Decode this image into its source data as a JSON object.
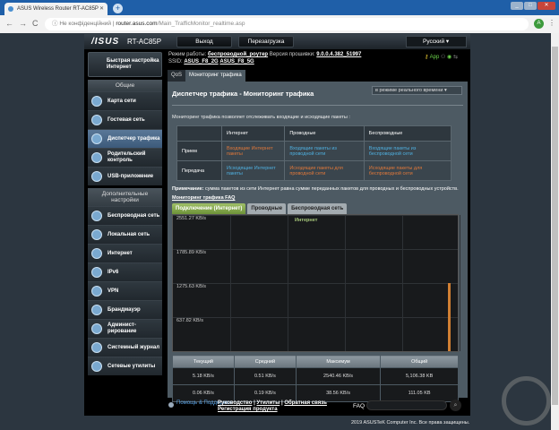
{
  "browser": {
    "tab_title": "ASUS Wireless Router RT-AC85P",
    "not_secure": "Не конфіденційний",
    "url_host": "router.asus.com",
    "url_path": "/Main_TrafficMonitor_realtime.asp",
    "profile": "A"
  },
  "header": {
    "logo": "/ISUS",
    "model": "RT-AC85P",
    "logout": "Выход",
    "reboot": "Перезагрузка",
    "language": "Русский"
  },
  "status": {
    "mode_label": "Режим работы:",
    "mode": "беспроводной_роутер",
    "fw_label": "Версия прошивки:",
    "fw": "9.0.0.4.382_51997",
    "ssid_label": "SSID:",
    "ssid1": "ASUS_F8_2G",
    "ssid2": "ASUS_F8_5G",
    "app": "App"
  },
  "sidebar": {
    "quick_setup": "Быстрая настройка Интернет",
    "general_title": "Общие",
    "general": [
      "Карта сети",
      "Гостевая сеть",
      "Диспетчер трафика",
      "Родительский контроль",
      "USB-приложение"
    ],
    "advanced_title": "Дополнительные настройки",
    "advanced": [
      "Беспроводная сеть",
      "Локальная сеть",
      "Интернет",
      "IPv6",
      "VPN",
      "Брандмауэр",
      "Админист­рирование",
      "Системный журнал",
      "Сетевые утилиты"
    ]
  },
  "content_tabs": [
    "QoS",
    "Мониторинг трафика"
  ],
  "page": {
    "title": "Диспетчер трафика - Мониторинг трафика",
    "mode_select": "в режиме реального времени",
    "desc": "Мониторинг трафика позволяет отслеживать входящие и исходящие пакеты :",
    "matrix": {
      "headers": [
        "",
        "Интернет",
        "Проводные",
        "Беспроводные"
      ],
      "rows": [
        [
          "Прием",
          "Входящие Интернет пакеты",
          "Входящие пакеты из проводной сети",
          "Входящие пакеты из беспроводной сети"
        ],
        [
          "Передача",
          "Исходящие Интернет пакеты",
          "Исходящие пакеты для проводной сети",
          "Исходящие пакеты для беспроводной сети"
        ]
      ]
    },
    "note_label": "Примечание:",
    "note": " сумма пакетов из сети Интернет равна сумме переданных пакетов для проводных и беспроводных устройств.",
    "faq_link": "Мониторинг трафика FAQ",
    "graph_tabs": [
      "Подключение (Интернет)",
      "Проводные",
      "Беспроводная сеть"
    ]
  },
  "chart_data": {
    "type": "bar",
    "title": "Интернет",
    "y_ticks": [
      "2551.27 KB/s",
      "1785.89 KB/s",
      "1275.63 KB/s",
      "637.82 KB/s"
    ],
    "ylim": [
      0,
      2551.27
    ],
    "series": [
      {
        "name": "Прием",
        "color": "#d07f33",
        "values": [
          1275
        ]
      }
    ]
  },
  "stats": {
    "headers": [
      "Текущий",
      "Средний",
      "Максимум",
      "Общий"
    ],
    "rows": [
      [
        "5.18 KB/s",
        "0.51 KB/s",
        "2540.46 KB/s",
        "5,106.38 KB"
      ],
      [
        "0.06 KB/s",
        "0.19 KB/s",
        "38.56 KB/s",
        "111.05 KB"
      ]
    ]
  },
  "footer": {
    "help": "Помощь & Поддержка",
    "links": [
      "Руководство",
      "Утилиты",
      "Обратная связь",
      "Регистрация продукта"
    ],
    "faq": "FAQ",
    "copyright": "2019 ASUSTeK Computer Inc. Все права защищены."
  }
}
